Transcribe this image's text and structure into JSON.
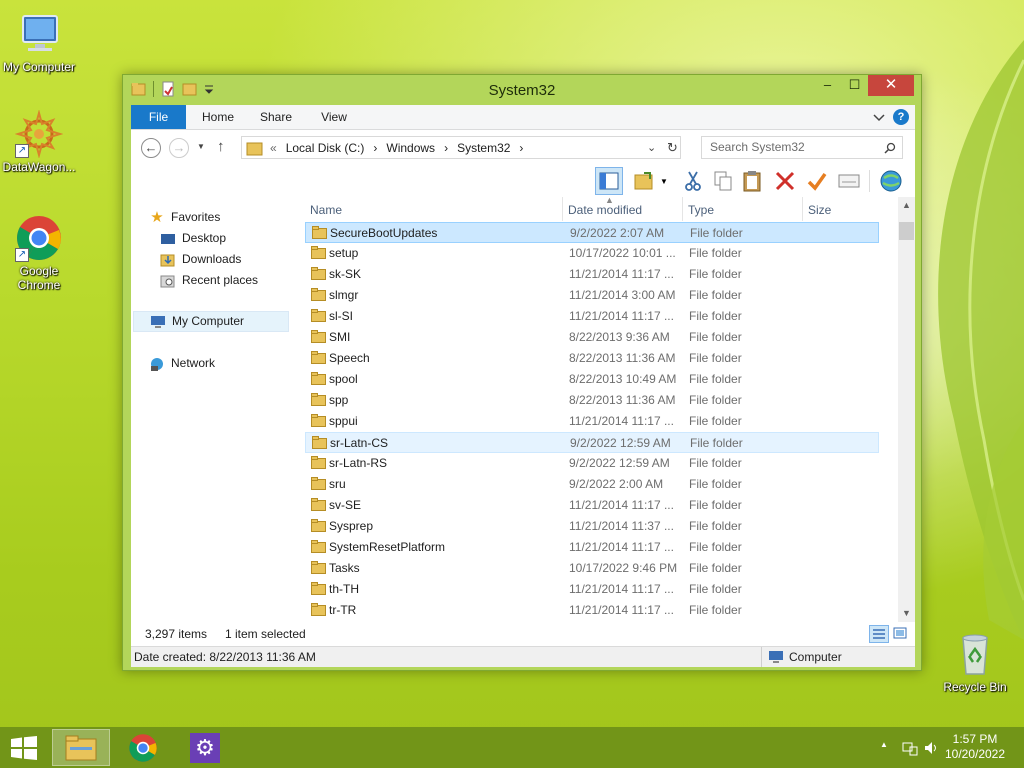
{
  "desktop": {
    "icons": [
      {
        "label": "My Computer",
        "icon": "computer-icon"
      },
      {
        "label": "DataWagon...",
        "icon": "datawagon-icon"
      },
      {
        "label": "Google Chrome",
        "icon": "chrome-icon"
      },
      {
        "label": "Recycle Bin",
        "icon": "recycle-bin-icon"
      }
    ]
  },
  "window": {
    "title": "System32",
    "controls": {
      "minimize": "–",
      "maximize": "☐",
      "close": "✕"
    },
    "ribbon_tabs": [
      "File",
      "Home",
      "Share",
      "View"
    ],
    "help": "?",
    "address": {
      "prefix": "«",
      "crumbs": [
        "Local Disk (C:)",
        "Windows",
        "System32"
      ],
      "separator": "›"
    },
    "search_placeholder": "Search System32",
    "nav": {
      "favorites": "Favorites",
      "desktop": "Desktop",
      "downloads": "Downloads",
      "recent": "Recent places",
      "my_computer": "My Computer",
      "network": "Network"
    },
    "columns": {
      "name": "Name",
      "date": "Date modified",
      "type": "Type",
      "size": "Size"
    },
    "files": [
      {
        "name": "SecureBootUpdates",
        "date": "9/2/2022 2:07 AM",
        "type": "File folder",
        "state": "selected"
      },
      {
        "name": "setup",
        "date": "10/17/2022 10:01 ...",
        "type": "File folder",
        "state": ""
      },
      {
        "name": "sk-SK",
        "date": "11/21/2014 11:17 ...",
        "type": "File folder",
        "state": ""
      },
      {
        "name": "slmgr",
        "date": "11/21/2014 3:00 AM",
        "type": "File folder",
        "state": ""
      },
      {
        "name": "sl-SI",
        "date": "11/21/2014 11:17 ...",
        "type": "File folder",
        "state": ""
      },
      {
        "name": "SMI",
        "date": "8/22/2013 9:36 AM",
        "type": "File folder",
        "state": ""
      },
      {
        "name": "Speech",
        "date": "8/22/2013 11:36 AM",
        "type": "File folder",
        "state": ""
      },
      {
        "name": "spool",
        "date": "8/22/2013 10:49 AM",
        "type": "File folder",
        "state": ""
      },
      {
        "name": "spp",
        "date": "8/22/2013 11:36 AM",
        "type": "File folder",
        "state": ""
      },
      {
        "name": "sppui",
        "date": "11/21/2014 11:17 ...",
        "type": "File folder",
        "state": ""
      },
      {
        "name": "sr-Latn-CS",
        "date": "9/2/2022 12:59 AM",
        "type": "File folder",
        "state": "hover"
      },
      {
        "name": "sr-Latn-RS",
        "date": "9/2/2022 12:59 AM",
        "type": "File folder",
        "state": ""
      },
      {
        "name": "sru",
        "date": "9/2/2022 2:00 AM",
        "type": "File folder",
        "state": ""
      },
      {
        "name": "sv-SE",
        "date": "11/21/2014 11:17 ...",
        "type": "File folder",
        "state": ""
      },
      {
        "name": "Sysprep",
        "date": "11/21/2014 11:37 ...",
        "type": "File folder",
        "state": ""
      },
      {
        "name": "SystemResetPlatform",
        "date": "11/21/2014 11:17 ...",
        "type": "File folder",
        "state": ""
      },
      {
        "name": "Tasks",
        "date": "10/17/2022 9:46 PM",
        "type": "File folder",
        "state": ""
      },
      {
        "name": "th-TH",
        "date": "11/21/2014 11:17 ...",
        "type": "File folder",
        "state": ""
      },
      {
        "name": "tr-TR",
        "date": "11/21/2014 11:17 ...",
        "type": "File folder",
        "state": ""
      }
    ],
    "status": {
      "count": "3,297 items",
      "selected": "1 item selected"
    },
    "details": {
      "date_created": "Date created: 8/22/2013 11:36 AM",
      "location": "Computer"
    }
  },
  "taskbar": {
    "apps": [
      "file-explorer-icon",
      "chrome-icon",
      "settings-icon"
    ],
    "tray_arrow": "▲",
    "time": "1:57 PM",
    "date": "10/20/2022"
  },
  "colors": {
    "accent": "#1979ca",
    "window_frame": "#b3d65a",
    "close": "#c7463d",
    "folder": "#e8c35a"
  }
}
